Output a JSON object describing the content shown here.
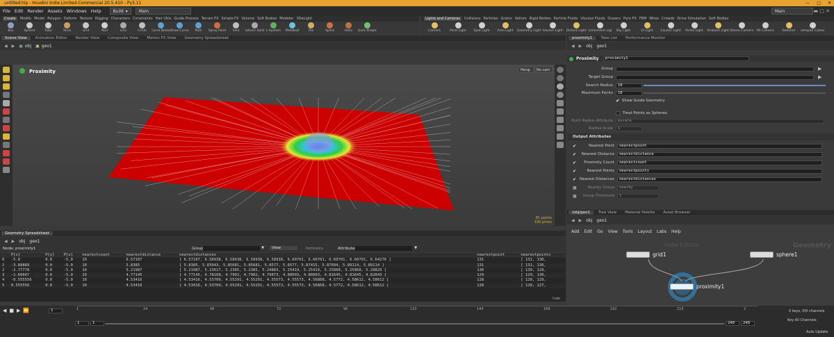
{
  "window": {
    "title": "untitled.hip - Houdini Indie Limited-Commercial 20.5.410 - Py3.11"
  },
  "menu": {
    "items": [
      "File",
      "Edit",
      "Render",
      "Assets",
      "Windows",
      "Help"
    ],
    "desktop": "Build",
    "desktop2": "Main",
    "right_desktop": "Main"
  },
  "shelf_tabs_left": {
    "tabs": [
      "Create",
      "Modify",
      "Model",
      "Polygon",
      "Deform",
      "Texture",
      "Rigging",
      "Characters",
      "Constraints",
      "Hair Utils",
      "Guide Process",
      "Terrain FX",
      "Simple FX",
      "Volume",
      "Soft Bodies",
      "Modeler",
      "3DeLight"
    ]
  },
  "shelf_tabs_right": {
    "tabs": [
      "Lights and Cameras",
      "Collisions",
      "Particles",
      "Grains",
      "Vellum",
      "Rigid Bodies",
      "Particle Fluids",
      "Viscous Fluids",
      "Oceans",
      "Pyro FX",
      "FEM",
      "Wires",
      "Crowds",
      "Drive Simulation",
      "Soft Bodies"
    ]
  },
  "shelf_tools_left": [
    "Box",
    "Sphere",
    "Tube",
    "Torus",
    "Grid",
    "Null",
    "Line",
    "Circle",
    "Curve Bezier",
    "Draw Curve",
    "Path",
    "Spray Paint",
    "Font",
    "Platonic Solids",
    "L-System",
    "Metaball",
    "File",
    "Spiral",
    "Helix",
    "Quick Shapes"
  ],
  "shelf_tools_right": [
    "Camera",
    "Point Light",
    "Spot Light",
    "Area Light",
    "Geometry Light",
    "Volume Light",
    "Distant Light",
    "Environment Light",
    "Sky Light",
    "GI Light",
    "Caustic Light",
    "Portal Light",
    "Ambient Light",
    "Stereo Camera",
    "VR Camera",
    "Switcher",
    "Gamepad Camera"
  ],
  "left_pane_tabs": [
    "Scene View",
    "Animation Editor",
    "Render View",
    "Composite View",
    "Motion FX View",
    "Geometry Spreadsheet"
  ],
  "right_pane_tabs": [
    "proximity1",
    "Take List",
    "Performance Monitor"
  ],
  "viewport": {
    "path_obj": "obj",
    "path_geo": "geo1",
    "title": "Proximity",
    "persp": "Persp",
    "cam": "No cam",
    "stats": "81 points\n100 prims"
  },
  "params": {
    "node_type": "Proximity",
    "node_name": "proximity1",
    "group_label": "Group",
    "target_group_label": "Target Group",
    "search_radius_label": "Search Radius",
    "search_radius": "10",
    "max_points_label": "Maximum Points",
    "max_points": "10",
    "show_guide": "Show Guide Geometry",
    "treat_spheres": "Treat Points as Spheres",
    "point_radius_attr_label": "Point Radius Attribute",
    "point_radius_attr": "pscale",
    "radius_scale_label": "Radius Scale",
    "radius_scale": "1",
    "output_header": "Output Attributes",
    "rows": [
      {
        "label": "Nearest Point",
        "value": "nearestpoint"
      },
      {
        "label": "Nearest Distance",
        "value": "nearestdistance"
      },
      {
        "label": "Proximity Count",
        "value": "nearestcount"
      },
      {
        "label": "Nearest Points",
        "value": "nearestpoints"
      },
      {
        "label": "Nearest Distances",
        "value": "nearestdistances"
      },
      {
        "label": "Nearby Group",
        "value": "nearby"
      },
      {
        "label": "Group Threshold",
        "value": "1"
      }
    ]
  },
  "spreadsheet": {
    "tab": "Geometry Spreadsheet",
    "path_obj": "obj",
    "path_geo": "geo1",
    "node": "Node: proximity1",
    "group_label": "Group:",
    "view": "View",
    "intrinsics": "Intrinsics",
    "attributes_label": "Attributes:",
    "headers": [
      "",
      "P[x]",
      "P[y]",
      "P[z]",
      "nearestcount",
      "nearestdistance",
      "nearestdistances",
      "nearestpoint",
      "nearestpoints"
    ],
    "rows": [
      [
        "0",
        "-5.0",
        "0.0",
        "-5.0",
        "10",
        "6.57107",
        "[ 6.57107, 6.58938, 6.58938, 6.58938, 6.58938, 6.60701, 6.60701, 6.60701, 6.60701, 6.64276 ]",
        "131",
        "[ 131, 130,"
      ],
      [
        "1",
        "-3.88889",
        "0.0",
        "-5.0",
        "10",
        "5.8385",
        "[ 5.8385, 5.83943, 5.85681, 5.85681, 5.8577, 5.8577, 5.87415, 5.87694, 5.89114, 5.89114 ]",
        "131",
        "[ 131, 130,"
      ],
      [
        "2",
        "-2.77778",
        "0.0",
        "-5.0",
        "10",
        "5.21987",
        "[ 5.21987, 5.23617, 5.2385, 5.2385, 5.24883, 5.25419, 5.25419, 5.25868, 5.25868, 5.28829 ]",
        "130",
        "[ 130, 129,"
      ],
      [
        "3",
        "-1.66667",
        "0.0",
        "-5.0",
        "10",
        "4.77145",
        "[ 4.77145, 4.78168, 4.7902, 4.7902, 4.79873, 4.80003, 4.80003, 4.81645, 4.81645, 4.82843 ]",
        "129",
        "[ 129, 130,"
      ],
      [
        "4",
        "-0.555556",
        "0.0",
        "-5.0",
        "10",
        "4.53416",
        "[ 4.53416, 4.53709, 4.55291, 4.55291, 4.55573, 4.55573, 4.56868, 4.5772, 4.58612, 4.58612 ]",
        "128",
        "[ 128, 129,"
      ],
      [
        "5",
        "0.555556",
        "0.0",
        "-5.0",
        "10",
        "4.53416",
        "[ 4.53416, 4.53709, 4.55291, 4.55291, 4.55573, 4.55573, 4.56868, 4.5772, 4.58612, 4.58612 ]",
        "128",
        "[ 128, 127,"
      ]
    ],
    "index_label": "Inde"
  },
  "network": {
    "tabs": [
      "/obj/geo1",
      "Tree View",
      "Material Palette",
      "Asset Browser"
    ],
    "path_obj": "obj",
    "path_geo": "geo1",
    "menu": [
      "Add",
      "Edit",
      "Go",
      "View",
      "Tools",
      "Layout",
      "Labs",
      "Help"
    ],
    "watermark": "Indie Edition",
    "context": "Geometry",
    "nodes": [
      "grid1",
      "sphere1",
      "proximity1"
    ]
  },
  "timeline": {
    "frame": "1",
    "start": "1",
    "start2": "1",
    "end": "240",
    "end2": "240",
    "ticks": [
      "1",
      "24",
      "48",
      "72",
      "96",
      "120",
      "144",
      "168",
      "192",
      "216",
      "2"
    ],
    "keys": "0 keys, 0/0 channels",
    "channels": "Key All Channels",
    "auto_update": "Auto Update"
  }
}
